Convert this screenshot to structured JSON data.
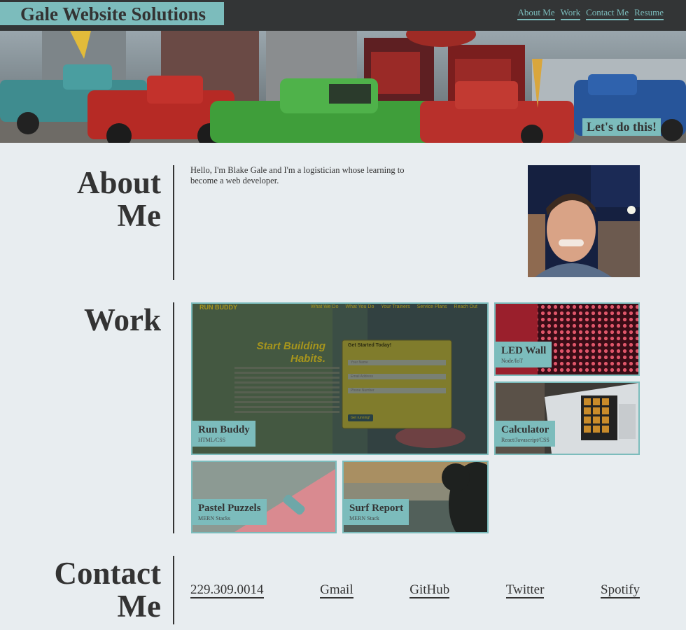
{
  "header": {
    "brand": "Gale Website Solutions",
    "nav": [
      "About Me",
      "Work",
      "Contact Me",
      "Resume"
    ]
  },
  "hero": {
    "cta_label": "Let's do this!"
  },
  "about": {
    "title_line1": "About",
    "title_line2": "Me",
    "text": "Hello, I'm Blake Gale and I'm a logistician whose learning to become a web developer."
  },
  "work": {
    "title": "Work",
    "projects": [
      {
        "title": "Run Buddy",
        "stack": "HTML/CSS"
      },
      {
        "title": "LED Wall",
        "stack": "Node/IoT"
      },
      {
        "title": "Calculator",
        "stack": "React/Javascript/CSS"
      },
      {
        "title": "Pastel Puzzels",
        "stack": "MERN Stacks"
      },
      {
        "title": "Surf Report",
        "stack": "MERN Stack"
      }
    ],
    "run_buddy_screenshot": {
      "brand": "RUN BUDDY",
      "nav": [
        "What We Do",
        "What You Do",
        "Your Trainers",
        "Service Plans",
        "Reach Out"
      ],
      "headline_line1": "Start Building",
      "headline_line2": "Habits.",
      "form_title": "Get Started Today!",
      "name_placeholder": "Your Name",
      "email_placeholder": "Email Address",
      "phone_placeholder": "Phone Number",
      "submit_label": "Get running!"
    }
  },
  "contact": {
    "title_line1": "Contact",
    "title_line2": "Me",
    "links": [
      "229.309.0014",
      "Gmail",
      "GitHub",
      "Twitter",
      "Spotify"
    ]
  },
  "colors": {
    "accent": "#7cbcbc",
    "header_bg": "#333536",
    "page_bg": "#e8edf0",
    "text": "#333333"
  }
}
